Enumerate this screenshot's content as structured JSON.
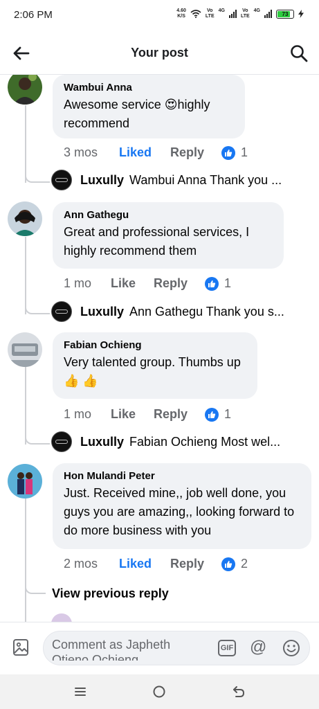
{
  "status_bar": {
    "time": "2:06 PM",
    "net_speed_value": "4.60",
    "net_speed_unit": "K/S",
    "sim1_top": "Vo",
    "sim1_bottom": "LTE",
    "sim1_net": "4G",
    "sim2_top": "Vo",
    "sim2_bottom": "LTE",
    "sim2_net": "4G",
    "battery": "73"
  },
  "header": {
    "title": "Your post",
    "back_icon": "arrow-left-icon",
    "search_icon": "search-icon"
  },
  "comments": [
    {
      "author": "Wambui Anna",
      "text": "Awesome service 😍highly recommend",
      "time": "3 mos",
      "like_label": "Liked",
      "liked": true,
      "reply_label": "Reply",
      "reactions": "1",
      "page_reply": {
        "name": "Luxully",
        "text": "Wambui Anna Thank you ..."
      }
    },
    {
      "author": "Ann Gathegu",
      "text": "Great and professional services, I highly recommend them",
      "time": "1 mo",
      "like_label": "Like",
      "liked": false,
      "reply_label": "Reply",
      "reactions": "1",
      "page_reply": {
        "name": "Luxully",
        "text": "Ann Gathegu Thank you s..."
      }
    },
    {
      "author": "Fabian Ochieng",
      "text": "Very talented group. Thumbs up👍 👍",
      "time": "1 mo",
      "like_label": "Like",
      "liked": false,
      "reply_label": "Reply",
      "reactions": "1",
      "page_reply": {
        "name": "Luxully",
        "text": "Fabian Ochieng Most wel..."
      }
    },
    {
      "author": "Hon Mulandi Peter",
      "text": "Just. Received mine,, job well done, you guys you are amazing,, looking forward to do more business with you",
      "time": "2 mos",
      "like_label": "Liked",
      "liked": true,
      "reply_label": "Reply",
      "reactions": "2",
      "view_previous": "View previous reply"
    }
  ],
  "comment_bar": {
    "placeholder": "Comment as Japheth Otieno Ochieng",
    "gif_label": "GIF",
    "at_label": "@"
  },
  "colors": {
    "accent": "#1877f2",
    "bubble": "#f0f2f5",
    "muted": "#65676b"
  }
}
